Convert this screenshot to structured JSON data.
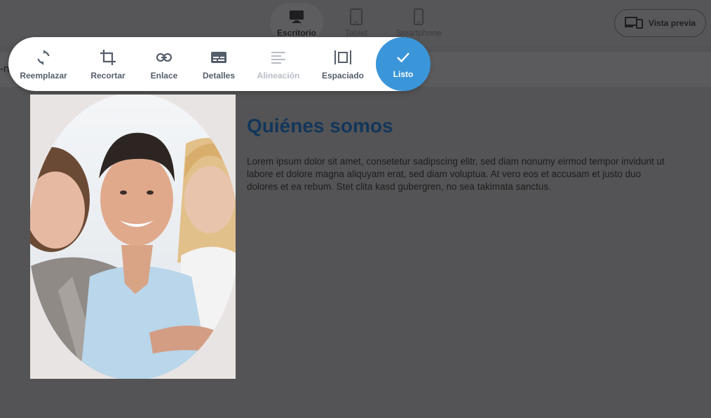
{
  "device_tabs": [
    {
      "label": "Escritorio",
      "icon": "desktop-icon",
      "active": true
    },
    {
      "label": "Tablet",
      "icon": "tablet-icon",
      "active": false
    },
    {
      "label": "Smartphone",
      "icon": "smartphone-icon",
      "active": false
    }
  ],
  "preview": {
    "label": "Vista previa",
    "icon": "responsive-devices-icon"
  },
  "strip_text": "-n",
  "toolbar": {
    "items": [
      {
        "label": "Reemplazar",
        "icon": "replace-icon",
        "enabled": true
      },
      {
        "label": "Recortar",
        "icon": "crop-icon",
        "enabled": true
      },
      {
        "label": "Enlace",
        "icon": "link-icon",
        "enabled": true
      },
      {
        "label": "Detalles",
        "icon": "details-icon",
        "enabled": true
      },
      {
        "label": "Alineación",
        "icon": "align-icon",
        "enabled": false
      },
      {
        "label": "Espaciado",
        "icon": "spacing-icon",
        "enabled": true
      }
    ],
    "done_label": "Listo",
    "accent": "#3a95d9"
  },
  "content": {
    "heading": "Quiénes somos",
    "body": "Lorem ipsum dolor sit amet, consetetur sadipscing elitr, sed diam nonumy eirmod tempor invidunt ut labore et dolore magna aliquyam erat, sed diam voluptua. At vero eos et accusam et justo duo dolores et ea rebum. Stet clita kasd gubergren, no sea takimata sanctus.",
    "image": "team-photo"
  }
}
